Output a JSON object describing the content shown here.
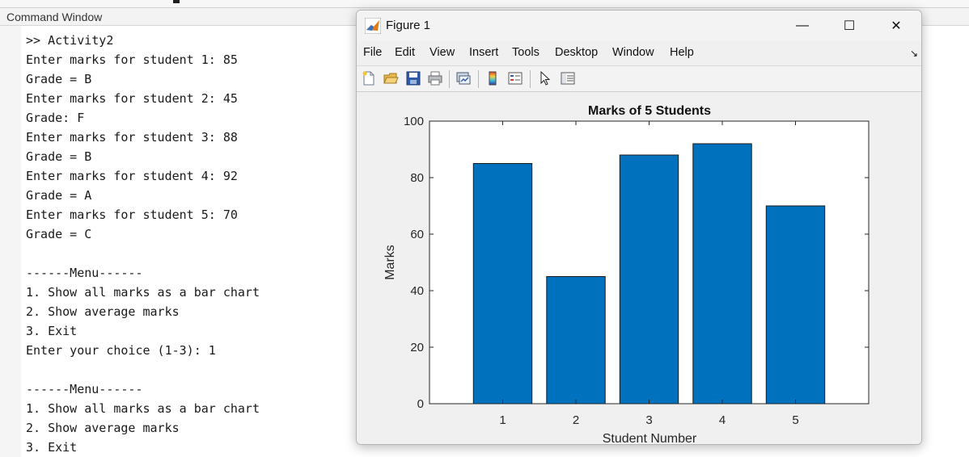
{
  "command_window": {
    "title": "Command Window",
    "lines": [
      ">> Activity2",
      "Enter marks for student 1: 85",
      "Grade = B",
      "Enter marks for student 2: 45",
      "Grade: F",
      "Enter marks for student 3: 88",
      "Grade = B",
      "Enter marks for student 4: 92",
      "Grade = A",
      "Enter marks for student 5: 70",
      "Grade = C",
      "",
      "------Menu------",
      "1. Show all marks as a bar chart",
      "2. Show average marks",
      "3. Exit",
      "Enter your choice (1-3): 1",
      "",
      "------Menu------",
      "1. Show all marks as a bar chart",
      "2. Show average marks",
      "3. Exit"
    ]
  },
  "figure": {
    "title": "Figure 1",
    "window_buttons": {
      "minimize": "—",
      "maximize": "☐",
      "close": "✕"
    },
    "menu": [
      "File",
      "Edit",
      "View",
      "Insert",
      "Tools",
      "Desktop",
      "Window",
      "Help"
    ],
    "toolbar_icons": [
      "new-figure-icon",
      "open-file-icon",
      "save-icon",
      "print-icon",
      "link-plot-icon",
      "colorbar-icon",
      "legend-icon",
      "pointer-icon",
      "property-inspector-icon"
    ]
  },
  "chart_data": {
    "type": "bar",
    "title": "Marks of 5 Students",
    "xlabel": "Student Number",
    "ylabel": "Marks",
    "categories": [
      "1",
      "2",
      "3",
      "4",
      "5"
    ],
    "values": [
      85,
      45,
      88,
      92,
      70
    ],
    "xlim": [
      0,
      6
    ],
    "ylim": [
      0,
      100
    ],
    "yticks": [
      0,
      20,
      40,
      60,
      80,
      100
    ],
    "bar_color": "#0072BD",
    "grid": false
  }
}
